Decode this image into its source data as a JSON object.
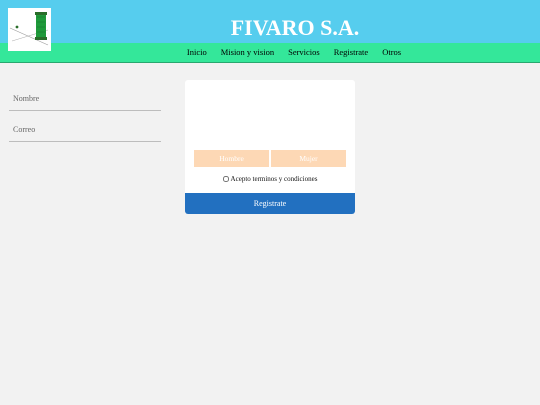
{
  "header": {
    "title": "FIVARO S.A.",
    "logo_icon": "thread-spool-logo-icon",
    "background": "#56cdee"
  },
  "nav": {
    "background": "#34e79a",
    "items": [
      {
        "label": "Inicio"
      },
      {
        "label": "Mision y vision"
      },
      {
        "label": "Servicios"
      },
      {
        "label": "Registrate"
      },
      {
        "label": "Otros"
      }
    ]
  },
  "form": {
    "name_placeholder": "Nombre",
    "name_value": "",
    "email_placeholder": "Correo",
    "email_value": "",
    "gender_options": [
      {
        "label": "Hombre"
      },
      {
        "label": "Mujer"
      }
    ],
    "terms_label": "Acepto terminos y condiciones",
    "terms_checked": false,
    "submit_label": "Registrate",
    "submit_color": "#2270c0",
    "gender_color": "#fdd8b5"
  }
}
